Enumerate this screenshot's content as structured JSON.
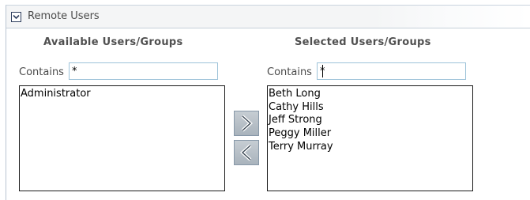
{
  "section": {
    "title": "Remote Users",
    "toggle_icon": "collapse-chevron-icon"
  },
  "available": {
    "title": "Available Users/Groups",
    "contains_label": "Contains",
    "filter_value": "*",
    "items": [
      "Administrator"
    ]
  },
  "selected": {
    "title": "Selected Users/Groups",
    "contains_label": "Contains",
    "filter_value": "*",
    "items": [
      "Beth Long",
      "Cathy Hills",
      "Jeff Strong",
      "Peggy Miller",
      "Terry Murray"
    ]
  },
  "buttons": {
    "add_icon": "chevron-right-icon",
    "remove_icon": "chevron-left-icon"
  }
}
